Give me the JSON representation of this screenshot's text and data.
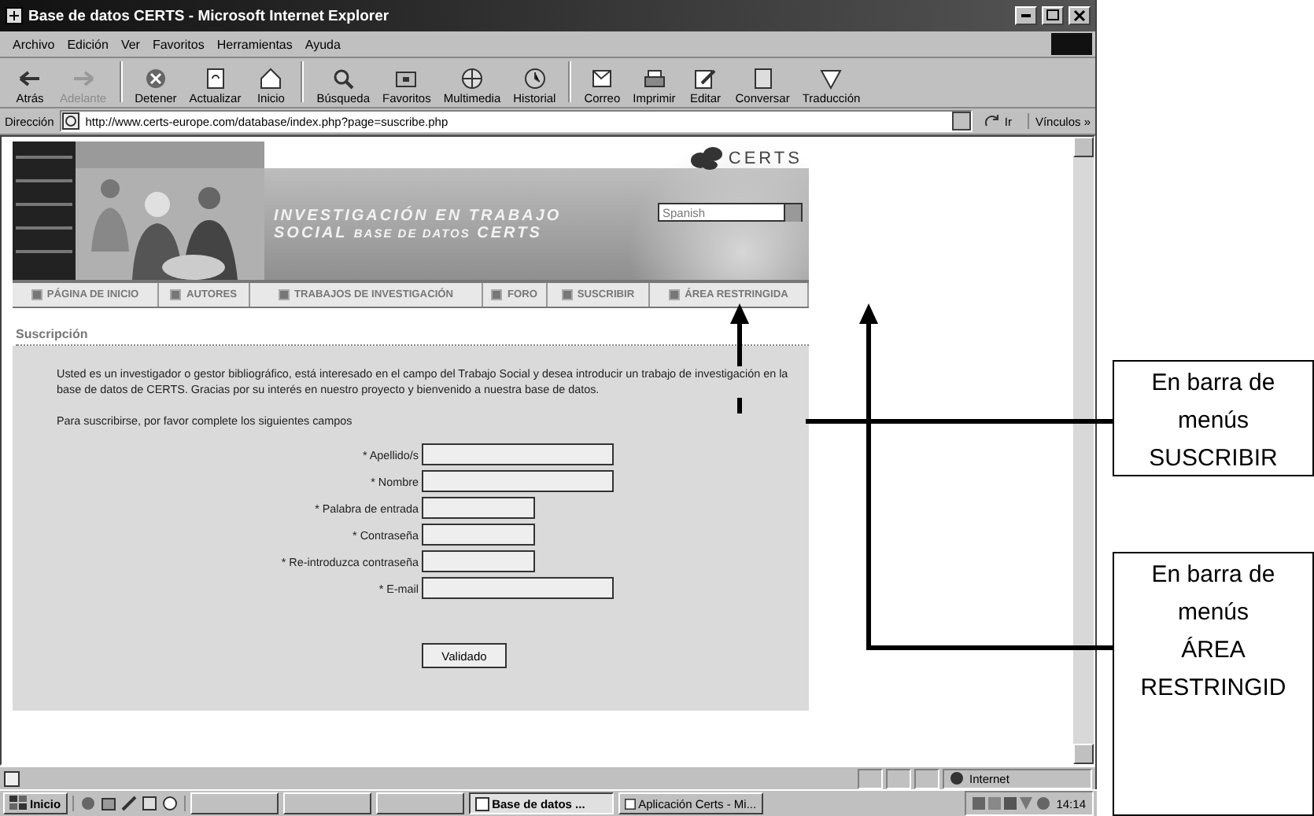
{
  "window": {
    "title": "Base de datos CERTS - Microsoft Internet Explorer"
  },
  "menu_bar": [
    "Archivo",
    "Edición",
    "Ver",
    "Favoritos",
    "Herramientas",
    "Ayuda"
  ],
  "toolbar": [
    {
      "label": "Atrás",
      "disabled": false
    },
    {
      "label": "Adelante",
      "disabled": true
    },
    {
      "label": "Detener",
      "disabled": false
    },
    {
      "label": "Actualizar",
      "disabled": false
    },
    {
      "label": "Inicio",
      "disabled": false
    },
    {
      "label": "Búsqueda",
      "disabled": false
    },
    {
      "label": "Favoritos",
      "disabled": false
    },
    {
      "label": "Multimedia",
      "disabled": false
    },
    {
      "label": "Historial",
      "disabled": false
    },
    {
      "label": "Correo",
      "disabled": false
    },
    {
      "label": "Imprimir",
      "disabled": false
    },
    {
      "label": "Editar",
      "disabled": false
    },
    {
      "label": "Conversar",
      "disabled": false
    },
    {
      "label": "Traducción",
      "disabled": false
    }
  ],
  "address_bar": {
    "label": "Dirección",
    "value": "http://www.certs-europe.com/database/index.php?page=suscribe.php",
    "go": "Ir",
    "links": "Vínculos »"
  },
  "site": {
    "logo": "CERTS",
    "banner_title": "INVESTIGACIÓN EN TRABAJO",
    "banner_title_2": "SOCIAL",
    "banner_subtitle": "BASE DE DATOS",
    "banner_brand": "CERTS",
    "language": "Spanish",
    "nav": [
      {
        "label": "PÁGINA DE INICIO",
        "selected": false
      },
      {
        "label": "AUTORES",
        "selected": false
      },
      {
        "label": "TRABAJOS DE INVESTIGACIÓN",
        "selected": false
      },
      {
        "label": "FORO",
        "selected": false
      },
      {
        "label": "SUSCRIBIR",
        "selected": false
      },
      {
        "label": "ÁREA RESTRINGIDA",
        "selected": false
      }
    ],
    "section_title": "Suscripción",
    "intro": "Usted es un investigador o gestor bibliográfico, está interesado en el campo del Trabajo Social y desea introducir un trabajo de investigación en la base de datos de CERTS. Gracias por su interés en nuestro proyecto y bienvenido a nuestra base de datos.",
    "instructions": "Para suscribirse, por favor complete los siguientes campos",
    "fields": [
      {
        "label": "* Apellido/s",
        "kind": "long"
      },
      {
        "label": "* Nombre",
        "kind": "long"
      },
      {
        "label": "* Palabra de entrada",
        "kind": "short"
      },
      {
        "label": "* Contraseña",
        "kind": "short"
      },
      {
        "label": "* Re-introduzca contraseña",
        "kind": "short"
      },
      {
        "label": "* E-mail",
        "kind": "long"
      }
    ],
    "submit": "Validado"
  },
  "status_bar": {
    "zone": "Internet"
  },
  "taskbar": {
    "start": "Inicio",
    "tasks": [
      {
        "label": "Base de datos ...",
        "selected": true
      },
      {
        "label": "Aplicación Certs - Mi...",
        "selected": false
      }
    ],
    "clock": "14:14"
  },
  "callouts": [
    {
      "lines": [
        "En barra de",
        "menús",
        "SUSCRIBIR"
      ]
    },
    {
      "lines": [
        "En barra de",
        "menús",
        "ÁREA",
        "RESTRINGID"
      ]
    }
  ]
}
